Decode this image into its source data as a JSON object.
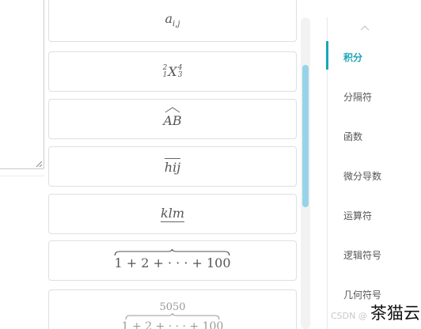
{
  "formulas": [
    {
      "tex": "a_{i,j}"
    },
    {
      "tex": "{}_1^2X_3^4"
    },
    {
      "tex": "\\widehat{AB}"
    },
    {
      "tex": "\\overline{hij}"
    },
    {
      "tex": "\\underline{klm}"
    },
    {
      "tex": "\\overbrace{1+2+\\cdots+100}"
    },
    {
      "tex": "\\overbrace{1+2+\\cdots+100}^{5050}",
      "label": "5050"
    }
  ],
  "categories": [
    {
      "label": "积分",
      "active": true
    },
    {
      "label": "分隔符"
    },
    {
      "label": "函数"
    },
    {
      "label": "微分导数"
    },
    {
      "label": "运算符"
    },
    {
      "label": "逻辑符号"
    },
    {
      "label": "几何符号"
    }
  ],
  "icons": {
    "nav_up": "chevron-up-icon",
    "resize": "resize-grip-icon"
  },
  "accent_color": "#1aa5b8",
  "watermark": {
    "prefix": "CSDN @",
    "text": "茶猫云"
  }
}
